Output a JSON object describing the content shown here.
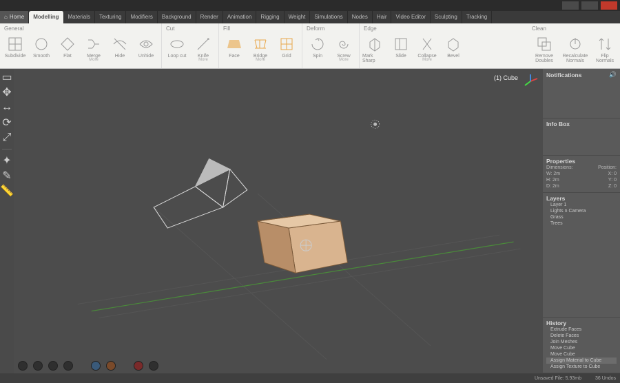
{
  "tabs": {
    "home": "Home",
    "list": [
      "Modelling",
      "Materials",
      "Texturing",
      "Modifiers",
      "Background",
      "Render",
      "Animation",
      "Rigging",
      "Weight",
      "Simulations",
      "Nodes",
      "Hair",
      "Video Editor",
      "Sculpting",
      "Tracking"
    ],
    "active": "Modelling"
  },
  "ribbon": {
    "general": {
      "title": "General",
      "subdivide": "Subdivide",
      "smooth": "Smooth",
      "flat": "Flat",
      "merge": "Merge",
      "hide": "Hide",
      "unhide": "Unhide",
      "more": "More"
    },
    "cut": {
      "title": "Cut",
      "loopcut": "Loop cut",
      "knife": "Knife",
      "more": "More"
    },
    "fill": {
      "title": "Fill",
      "face": "Face",
      "bridge": "Bridge",
      "grid": "Grid",
      "more": "More"
    },
    "deform": {
      "title": "Deform",
      "spin": "Spin",
      "screw": "Screw",
      "more": "More"
    },
    "edge": {
      "title": "Edge",
      "marksharp": "Mark Sharp",
      "slide": "Slide",
      "collapse": "Collapse",
      "bevel": "Bevel",
      "more": "More"
    },
    "clean": {
      "title": "Clean",
      "rmdoubles": "Remove Doubles",
      "recalc": "Recalculate Normals",
      "flip": "Flip Normals"
    }
  },
  "viewport": {
    "object_label": "(1) Cube"
  },
  "right": {
    "notifications": "Notifications",
    "infobox": "Info Box",
    "properties": {
      "title": "Properties",
      "dim_label": "Dimensions:",
      "pos_label": "Position:",
      "dim_w": "W: 2m",
      "dim_h": "H: 2m",
      "dim_d": "D: 2m",
      "pos_x": "X: 0",
      "pos_y": "Y: 0",
      "pos_z": "Z: 0"
    },
    "layers": {
      "title": "Layers",
      "items": [
        "Layer 1",
        "Lights n Camera",
        "Grass",
        "Trees"
      ]
    },
    "history": {
      "title": "History",
      "items": [
        "Extrude Faces",
        "Delete Faces",
        "Join Meshes",
        "Move Cube",
        "Move Cube",
        "Assign Material to Cube",
        "Assign Texture to Cube"
      ]
    }
  },
  "status": {
    "file": "Unsaved File: 5.93mb",
    "undos": "36 Undos"
  }
}
